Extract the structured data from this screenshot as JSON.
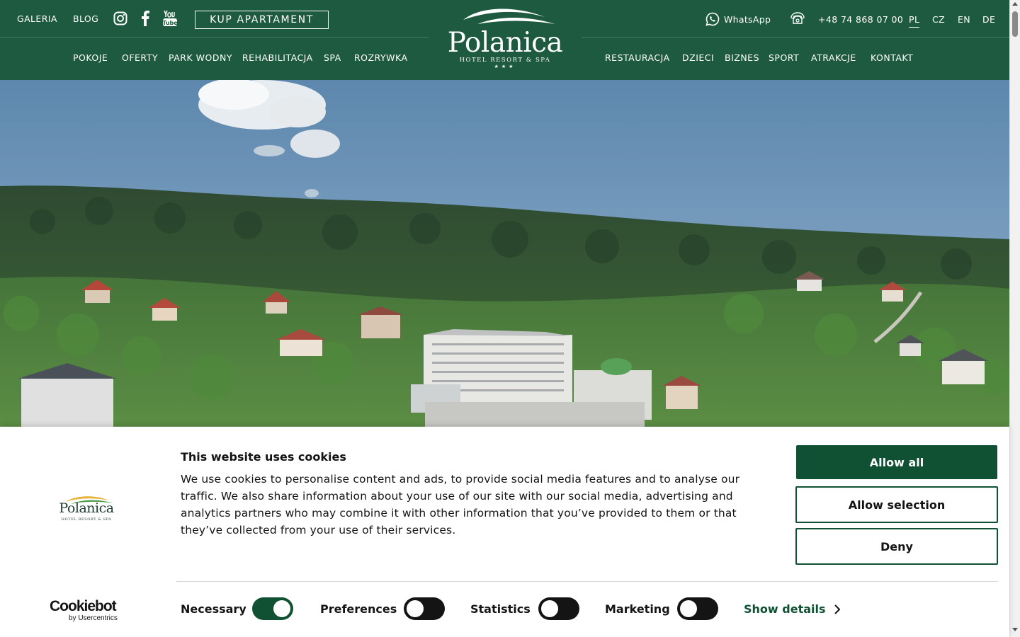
{
  "header": {
    "top_links": {
      "gallery": "GALERIA",
      "blog": "BLOG"
    },
    "social": [
      "instagram-icon",
      "facebook-icon",
      "youtube-icon"
    ],
    "buy_button": "KUP APARTAMENT",
    "whatsapp": "WhatsApp",
    "phone": "+48 74 868 07 00",
    "languages": [
      "PL",
      "CZ",
      "EN",
      "DE"
    ],
    "active_language": "PL",
    "nav_left": [
      "POKOJE",
      "OFERTY",
      "PARK WODNY",
      "REHABILITACJA",
      "SPA",
      "ROZRYWKA"
    ],
    "nav_right": [
      "RESTAURACJA",
      "DZIECI",
      "BIZNES",
      "SPORT",
      "ATRAKCJE",
      "KONTAKT"
    ],
    "logo": {
      "name": "Polanica",
      "subtitle": "HOTEL RESORT & SPA",
      "stars": "★★★"
    },
    "bg_color": "#1e5a3f"
  },
  "cookie_banner": {
    "title": "This website uses cookies",
    "body": "We use cookies to personalise content and ads, to provide social media features and to analyse our traffic. We also share information about your use of our site with our social media, advertising and analytics partners who may combine it with other information that you’ve provided to them or that they’ve collected from your use of their services.",
    "buttons": {
      "allow_all": "Allow all",
      "allow_selection": "Allow selection",
      "deny": "Deny"
    },
    "toggles": [
      {
        "label": "Necessary",
        "on": true
      },
      {
        "label": "Preferences",
        "on": false
      },
      {
        "label": "Statistics",
        "on": false
      },
      {
        "label": "Marketing",
        "on": false
      }
    ],
    "show_details": "Show details",
    "logo": {
      "name": "Polanica",
      "subtitle": "HOTEL RESORT & SPA"
    },
    "powered_by": {
      "brand": "Cookiebot",
      "by": "by Usercentrics"
    },
    "accent_color": "#0f5132"
  }
}
